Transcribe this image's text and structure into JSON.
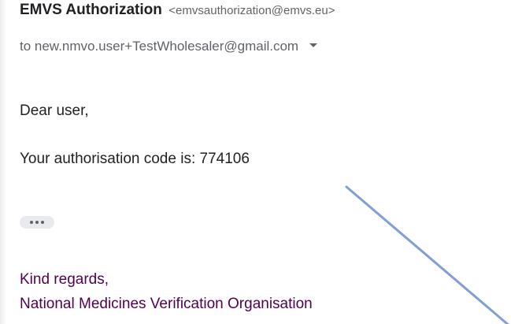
{
  "header": {
    "sender_name": "EMVS Authorization",
    "sender_email": "<emvsauthorization@emvs.eu>",
    "to_line": "to new.nmvo.user+TestWholesaler@gmail.com"
  },
  "message": {
    "greeting": "Dear user,",
    "code_text": "Your authorisation code is: 774106",
    "signature_line1": "Kind regards,",
    "signature_line2": "National Medicines Verification Organisation"
  },
  "annotation": {
    "arrow_color": "#7f9fd6"
  },
  "icons": {
    "recipient_details": "chevron-down-icon",
    "show_trimmed": "more-horizontal-icon"
  }
}
